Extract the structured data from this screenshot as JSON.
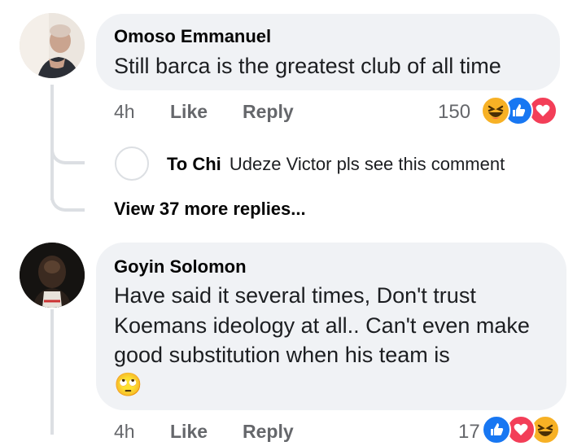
{
  "comments": [
    {
      "author": "Omoso Emmanuel",
      "text": "Still barca is the greatest club of all time",
      "time": "4h",
      "like_label": "Like",
      "reply_label": "Reply",
      "reaction_count": "150",
      "reactions": [
        "haha-icon",
        "like-icon",
        "love-icon"
      ]
    },
    {
      "author": "Goyin Solomon",
      "text": "Have said it several times, Don't trust Koemans ideology at all.. Can't even make good substitution when his team is",
      "emoji": "🙄",
      "time": "4h",
      "like_label": "Like",
      "reply_label": "Reply",
      "reaction_count": "17",
      "reactions": [
        "like-icon",
        "love-icon",
        "haha-icon"
      ]
    }
  ],
  "reply_preview": {
    "author": "To Chi",
    "text": "Udeze Victor pls see this comment"
  },
  "view_more_label": "View 37 more replies...",
  "colors": {
    "bubble": "#f0f2f5",
    "muted_text": "#65676b",
    "like_blue": "#1877f2",
    "love_red": "#f33e58",
    "haha_yellow": "#f7b125"
  }
}
